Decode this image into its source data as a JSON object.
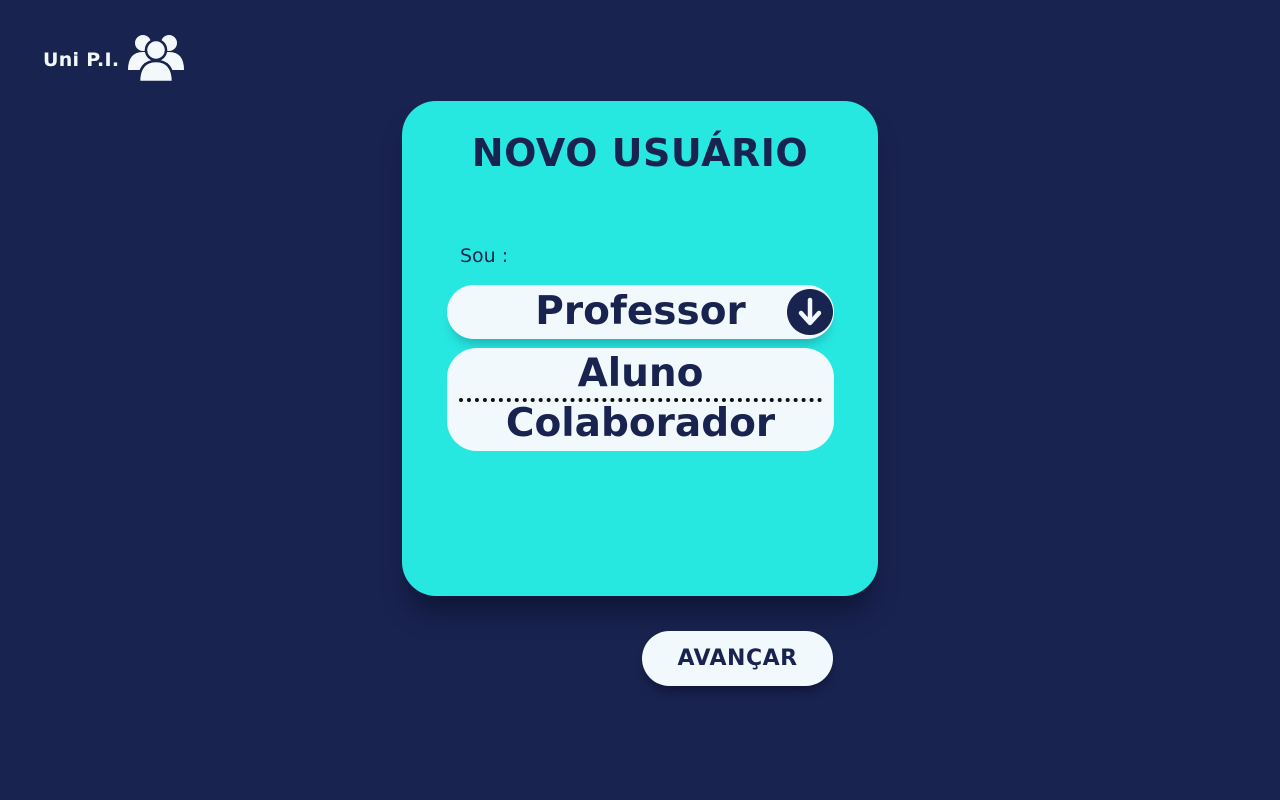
{
  "logo": {
    "text": "Uni P.I.",
    "icon": "users-group-icon"
  },
  "form": {
    "title": "NOVO USUÁRIO",
    "sou_label": "Sou  :",
    "select": {
      "selected": "Professor",
      "arrow_icon": "arrow-down-circle-icon",
      "options": [
        "Aluno",
        "Colaborador"
      ]
    },
    "next_button": "AVANÇAR"
  },
  "colors": {
    "background": "#19234f",
    "card": "#27e8e1",
    "field": "#f2f9fc",
    "text_dark": "#19234f"
  }
}
